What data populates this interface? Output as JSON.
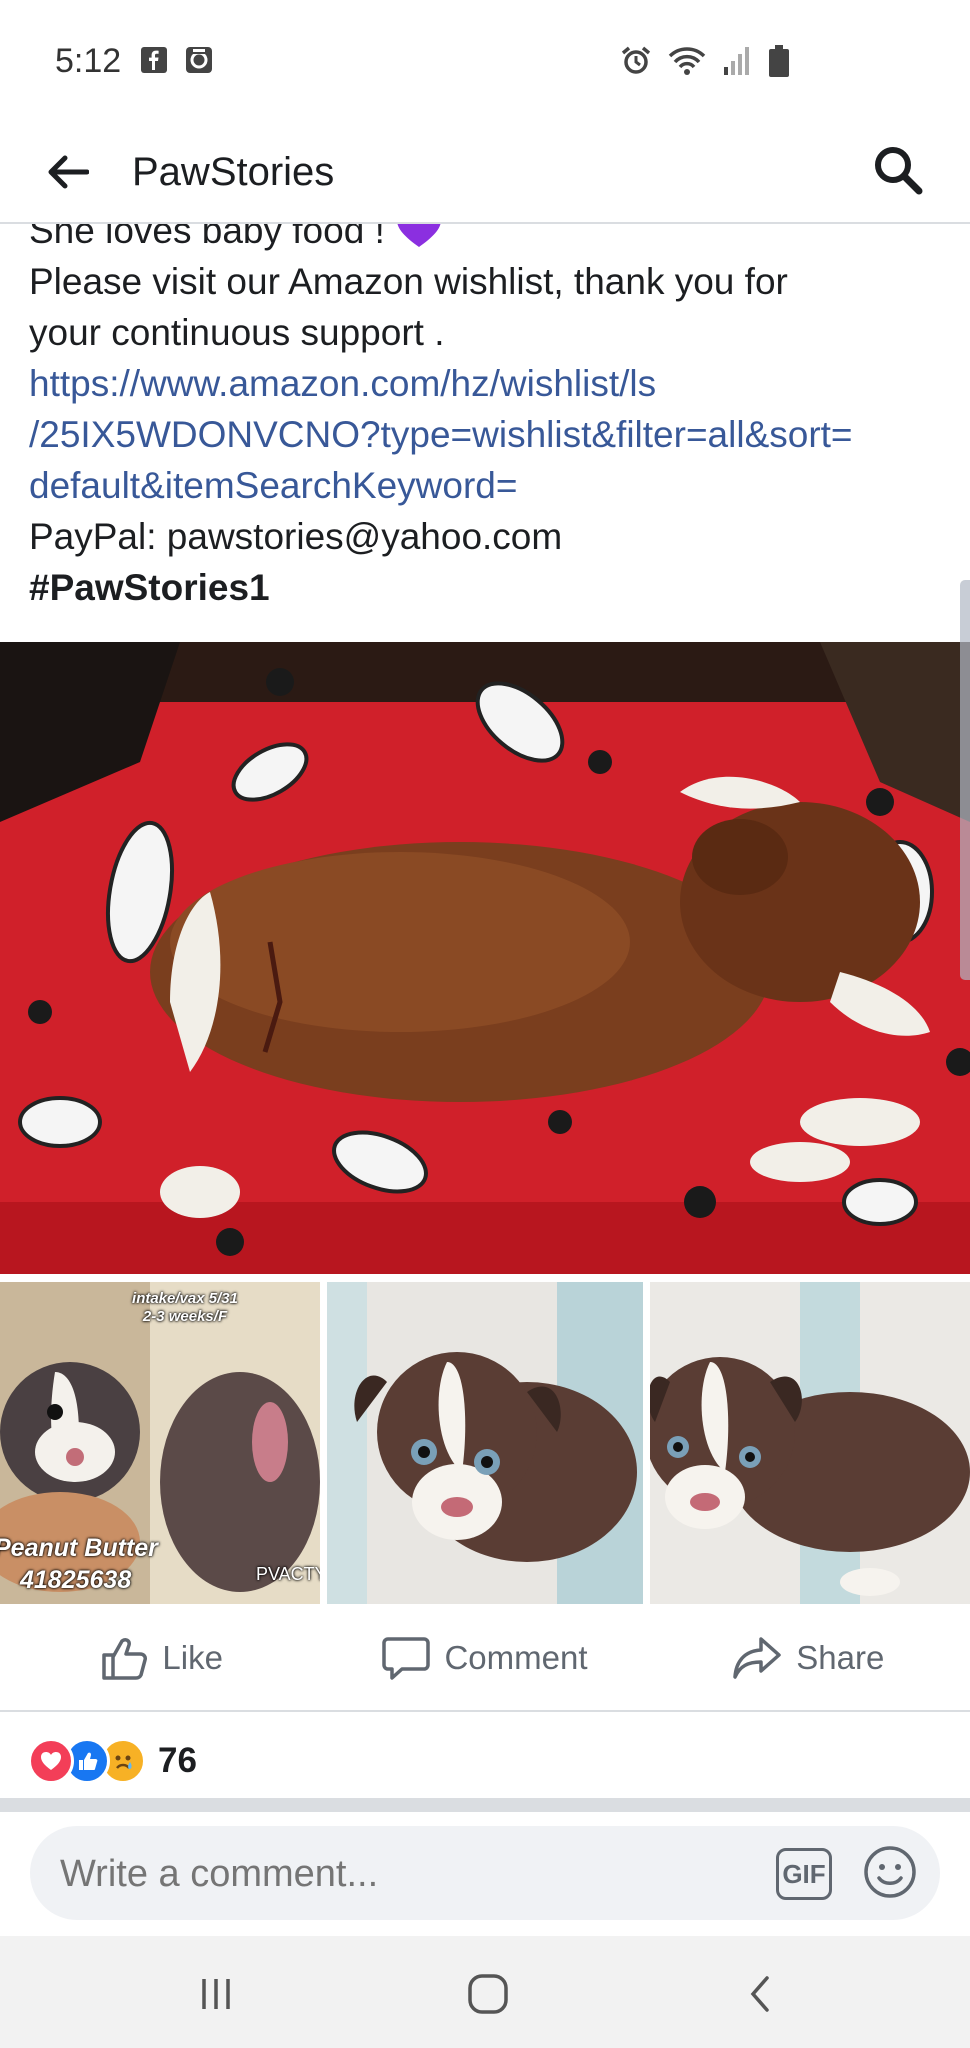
{
  "status_bar": {
    "time": "5:12"
  },
  "header": {
    "title": "PawStories"
  },
  "post": {
    "partial_line": "She loves baby food !",
    "line1": "Please visit our Amazon wishlist, thank you for",
    "line2": "your continuous support .",
    "link_line1": "https://www.amazon.com/hz/wishlist/ls",
    "link_line2": "/25IX5WDONVCNO?type=wishlist&filter=all&sort=",
    "link_line3": "default&itemSearchKeyword=",
    "paypal": "PayPal: pawstories@yahoo.com",
    "hashtag": "#PawStories1"
  },
  "photos": {
    "thumb1_top_label_1": "intake/vax 5/31",
    "thumb1_top_label_2": "2-3 weeks/F",
    "thumb1_name": "Peanut Butter",
    "thumb1_id": "41825638",
    "thumb1_watermark": "PVACTY"
  },
  "actions": {
    "like": "Like",
    "comment": "Comment",
    "share": "Share"
  },
  "reactions": {
    "count": "76"
  },
  "comment": {
    "placeholder": "Write a comment...",
    "gif": "GIF"
  },
  "colors": {
    "link": "#385898",
    "heart": "#f33e58",
    "like": "#1877f2",
    "sad": "#f7b125",
    "heart_emoji": "#8b2fe0"
  }
}
